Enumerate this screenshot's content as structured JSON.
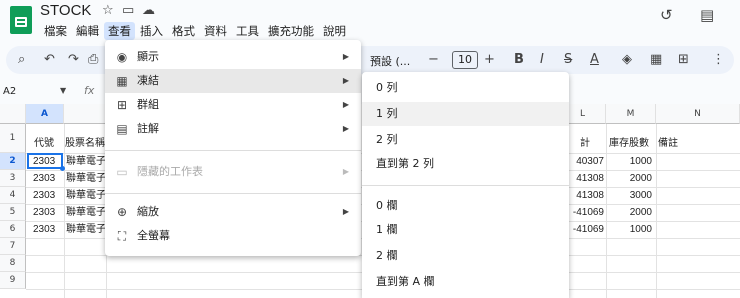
{
  "app": {
    "title": "STOCK"
  },
  "menubar": [
    "檔案",
    "編輯",
    "查看",
    "插入",
    "格式",
    "資料",
    "工具",
    "擴充功能",
    "說明"
  ],
  "toolbar": {
    "font": "預設 (...",
    "font_size": "10"
  },
  "formula_bar": {
    "cell_ref": "A2",
    "fx": "fx"
  },
  "columns": [
    "A",
    "L",
    "M",
    "N"
  ],
  "rows": [
    "1",
    "2",
    "3",
    "4",
    "5",
    "6",
    "7",
    "8",
    "9"
  ],
  "header_row": {
    "a": "代號",
    "b": "股票名稱",
    "l": "計",
    "m": "庫存股數",
    "n": "備註"
  },
  "data_rows": [
    {
      "a": "2303",
      "b": "聯華電子",
      "l": "40307",
      "m": "1000"
    },
    {
      "a": "2303",
      "b": "聯華電子",
      "l": "41308",
      "m": "2000"
    },
    {
      "a": "2303",
      "b": "聯華電子",
      "l": "41308",
      "m": "3000"
    },
    {
      "a": "2303",
      "b": "聯華電子",
      "l": "-41069",
      "m": "2000"
    },
    {
      "a": "2303",
      "b": "聯華電子",
      "l": "-41069",
      "m": "1000"
    }
  ],
  "view_menu": [
    {
      "icon": "eye-icon",
      "label": "顯示"
    },
    {
      "icon": "freeze-icon",
      "label": "凍結"
    },
    {
      "icon": "group-icon",
      "label": "群組"
    },
    {
      "icon": "comment-icon",
      "label": "註解"
    },
    {
      "icon": "hidden-sheets-icon",
      "label": "隱藏的工作表"
    },
    {
      "icon": "zoom-icon",
      "label": "縮放"
    },
    {
      "icon": "fullscreen-icon",
      "label": "全螢幕"
    }
  ],
  "freeze_submenu": {
    "rows": [
      "0 列",
      "1 列",
      "2 列"
    ],
    "rows_up_to": "直到第 2 列",
    "cols": [
      "0 欄",
      "1 欄",
      "2 欄"
    ],
    "cols_up_to": "直到第 A 欄"
  }
}
